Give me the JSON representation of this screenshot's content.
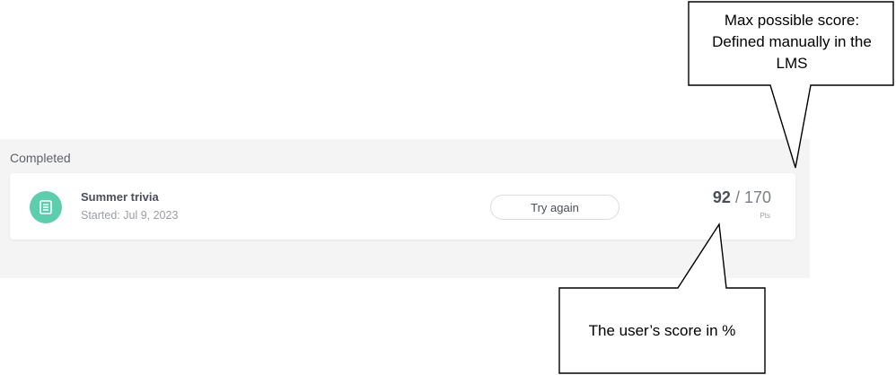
{
  "section": {
    "title": "Completed"
  },
  "item": {
    "icon": "document-icon",
    "title": "Summer trivia",
    "started": "Started: Jul 9, 2023",
    "button_label": "Try again",
    "score": "92",
    "separator": " / ",
    "max_score": "170",
    "score_unit": "Pts"
  },
  "callouts": {
    "top": {
      "line1": "Max possible score:",
      "line2": "Defined manually in the",
      "line3": "LMS"
    },
    "bottom": {
      "text": "The user’s score in %"
    }
  },
  "colors": {
    "icon_bg": "#5ccdad",
    "section_bg": "#f4f4f4"
  }
}
